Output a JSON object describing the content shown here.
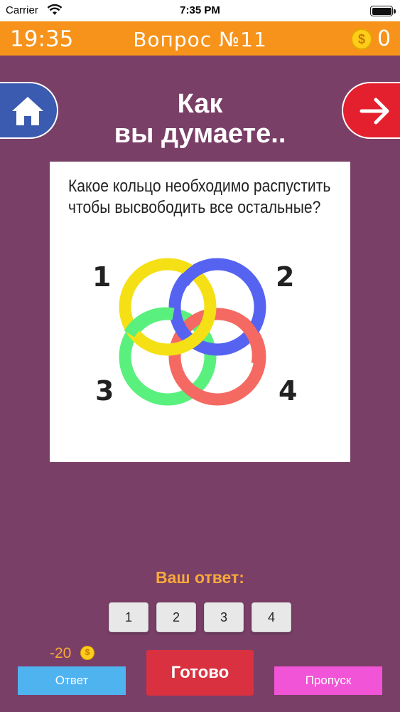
{
  "status_bar": {
    "carrier": "Carrier",
    "time": "7:35 PM"
  },
  "header": {
    "timer": "19:35",
    "title": "Вопрос №11",
    "coins": "0",
    "coin_symbol": "$"
  },
  "nav": {
    "home_icon": "home-icon",
    "next_icon": "arrow-right-icon"
  },
  "heading": {
    "line1": "Как",
    "line2": "вы думаете.."
  },
  "card": {
    "question": "Какое кольцо необходимо распустить чтобы высвободить все остальные?",
    "ring_labels": [
      "1",
      "2",
      "3",
      "4"
    ],
    "ring_colors": {
      "yellow": "#f5e015",
      "blue": "#5563f0",
      "green": "#5af07e",
      "red": "#f46a63"
    }
  },
  "answer": {
    "label": "Ваш ответ:",
    "options": [
      "1",
      "2",
      "3",
      "4"
    ]
  },
  "footer": {
    "hint_cost": "-20",
    "hint_coin_symbol": "$",
    "answer_label": "Ответ",
    "done_label": "Готово",
    "skip_label": "Пропуск"
  },
  "colors": {
    "background": "#7a3f67",
    "header": "#f7931a",
    "accent": "#f7a93a",
    "home": "#3a5bb0",
    "next": "#e5202e",
    "answer_button": "#4fb3f0",
    "done_button": "#d9313f",
    "skip_button": "#f154d6"
  }
}
